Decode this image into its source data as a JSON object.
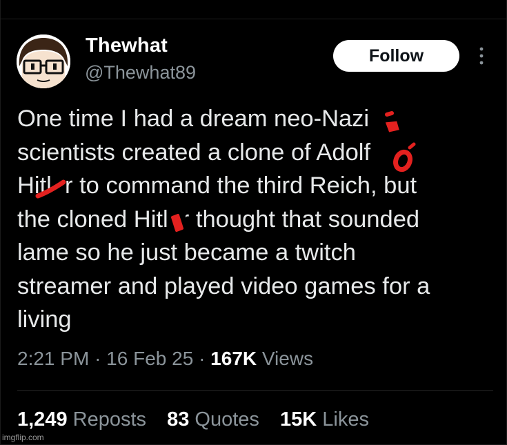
{
  "user": {
    "display_name": "Thewhat",
    "handle": "@Thewhat89"
  },
  "follow_button": {
    "label": "Follow"
  },
  "more_button": {
    "icon": "more-vertical-icon"
  },
  "tweet": {
    "lines": [
      "One time I had a dream neo-Nazi",
      "scientists created a clone of Adolf",
      "Hitler to command the third Reich, but",
      "the cloned Hitler thought that sounded",
      "lame so he just became a twitch",
      "streamer and played video games for a",
      "living"
    ]
  },
  "meta": {
    "time": "2:21 PM",
    "separator": "·",
    "date": "16 Feb 25",
    "views_count": "167K",
    "views_label": "Views"
  },
  "stats": {
    "reposts_count": "1,249",
    "reposts_label": "Reposts",
    "quotes_count": "83",
    "quotes_label": "Quotes",
    "likes_count": "15K",
    "likes_label": "Likes"
  },
  "watermark": "imgflip.com",
  "colors": {
    "background": "#000000",
    "text": "#e7e9ea",
    "secondary": "#8b949a",
    "censor_marks": "#e3211f"
  }
}
